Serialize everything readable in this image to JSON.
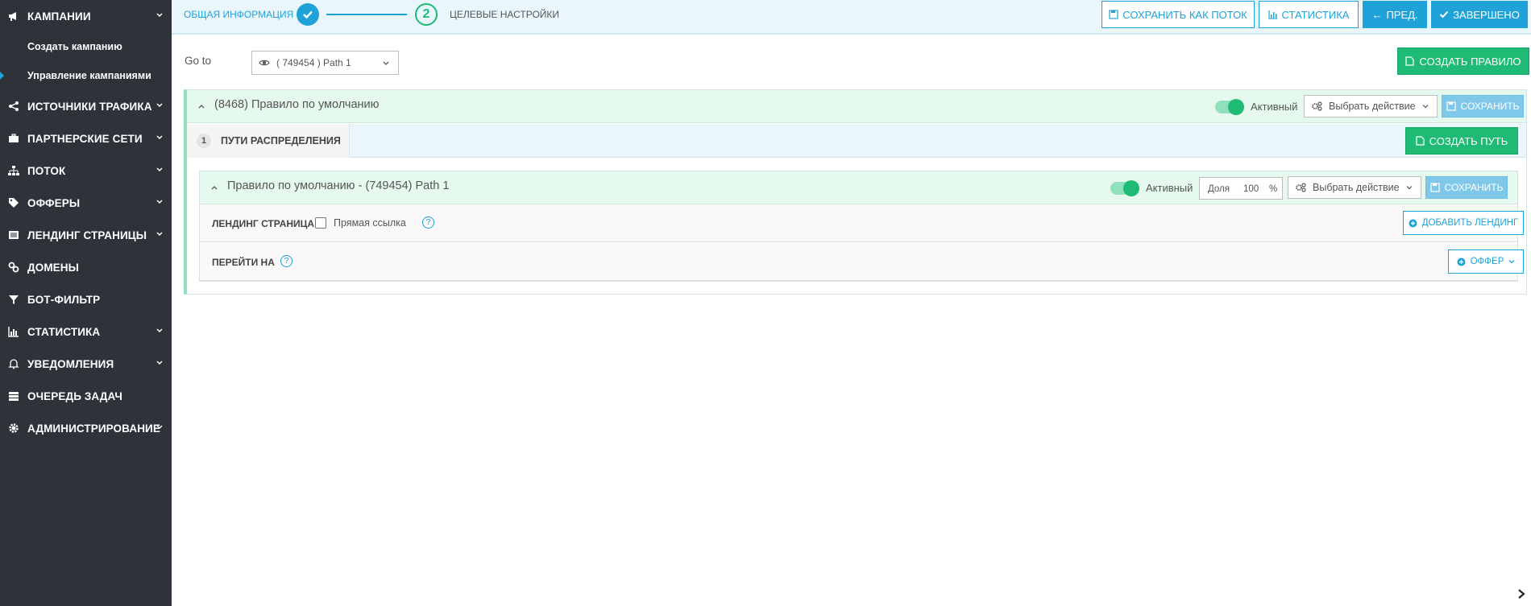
{
  "sidebar": {
    "items": [
      {
        "label": "Кампании",
        "icon": "megaphone-icon",
        "has_chevron": true
      },
      {
        "label": "Источники трафика",
        "icon": "share-icon",
        "has_chevron": true
      },
      {
        "label": "Партнерские сети",
        "icon": "briefcase-icon",
        "has_chevron": true
      },
      {
        "label": "Поток",
        "icon": "sitemap-icon",
        "has_chevron": true
      },
      {
        "label": "Офферы",
        "icon": "tags-icon",
        "has_chevron": true
      },
      {
        "label": "Лендинг страницы",
        "icon": "newspaper-icon",
        "has_chevron": true
      },
      {
        "label": "Домены",
        "icon": "link-icon",
        "has_chevron": false
      },
      {
        "label": "Бот-фильтр",
        "icon": "filter-icon",
        "has_chevron": false
      },
      {
        "label": "Статистика",
        "icon": "bar-chart-icon",
        "has_chevron": true
      },
      {
        "label": "Уведомления",
        "icon": "bell-icon",
        "has_chevron": true
      },
      {
        "label": "Очередь задач",
        "icon": "server-icon",
        "has_chevron": false
      },
      {
        "label": "Администрирование",
        "icon": "gear-icon",
        "has_chevron": true
      }
    ],
    "subitems": [
      {
        "label": "Создать кампанию",
        "active": false
      },
      {
        "label": "Управление кампаниями",
        "active": true
      }
    ]
  },
  "wizard": {
    "step1_label": "Общая информация",
    "step2_number": "2",
    "step2_label": "Целевые настройки"
  },
  "toolbar": {
    "save_as_flow": "Сохранить как поток",
    "statistics": "Статистика",
    "prev": "Пред.",
    "done": "Завершено"
  },
  "goto": {
    "label": "Go to",
    "selected": "( 749454 ) Path 1"
  },
  "create_rule_button": "Создать правило",
  "rule": {
    "title": "(8468) Правило по умолчанию",
    "active_label": "Активный",
    "action_select": "Выбрать действие",
    "save_label": "Сохранить"
  },
  "tabs": {
    "number": "1",
    "label": "Пути распределения",
    "create_path": "Создать путь"
  },
  "path": {
    "title": "Правило по умолчанию - (749454) Path 1",
    "active_label": "Активный",
    "share_label": "Доля",
    "share_value": "100",
    "share_unit": "%",
    "action_select": "Выбрать действие",
    "save_label": "Сохранить",
    "landing_row": {
      "label": "Лендинг страница",
      "direct_link_label": "Прямая ссылка",
      "help": "?",
      "add_landing": "Добавить лендинг"
    },
    "goto_row": {
      "label": "Перейти на",
      "help": "?",
      "offer_button": "Оффер"
    }
  },
  "colors": {
    "sidebar_bg": "#2d3338",
    "accent_blue": "#1fa2d8",
    "accent_green": "#1fba73",
    "rule_header_bg": "#e6f9ef",
    "topbar_bg": "#e9f7fc"
  }
}
